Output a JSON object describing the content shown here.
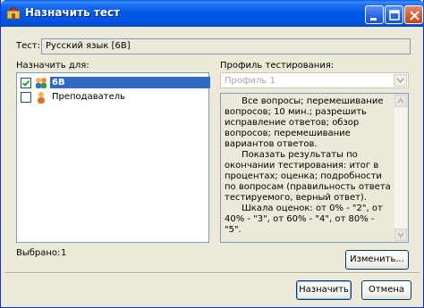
{
  "window": {
    "title": "Назначить тест",
    "controls": [
      "minimize-icon",
      "maximize-icon",
      "close-icon"
    ]
  },
  "test": {
    "label": "Тест:",
    "value": "Русский язык [6В]"
  },
  "assign": {
    "label": "Назначить для:",
    "items": [
      {
        "label": "6В",
        "checked": true,
        "selected": true,
        "icon": "group-icon"
      },
      {
        "label": "Преподаватель",
        "checked": false,
        "selected": false,
        "icon": "user-icon"
      }
    ]
  },
  "profile": {
    "label": "Профиль тестирования:",
    "selected": "Профиль 1",
    "description": "      Все вопросы; перемешивание вопросов; 10 мин.; разрешить исправление ответов; обзор вопросов; перемешивание вариантов ответов.\n      Показать результаты по окончании тестирования: итог в процентах; оценка; подробности по вопросам (правильность ответа тестируемого, верный ответ).\n      Шкала оценок: от 0% - \"2\", от 40% - \"3\", от 60% - \"4\", от 80% - \"5\"."
  },
  "selected_count": {
    "label": "Выбрано:",
    "value": "1"
  },
  "buttons": {
    "change": "Изменить...",
    "assign": "Назначить",
    "cancel": "Отмена"
  },
  "colors": {
    "titlebar": "#0054e0",
    "selection": "#316ac5",
    "dialog_bg": "#ece9d8"
  }
}
